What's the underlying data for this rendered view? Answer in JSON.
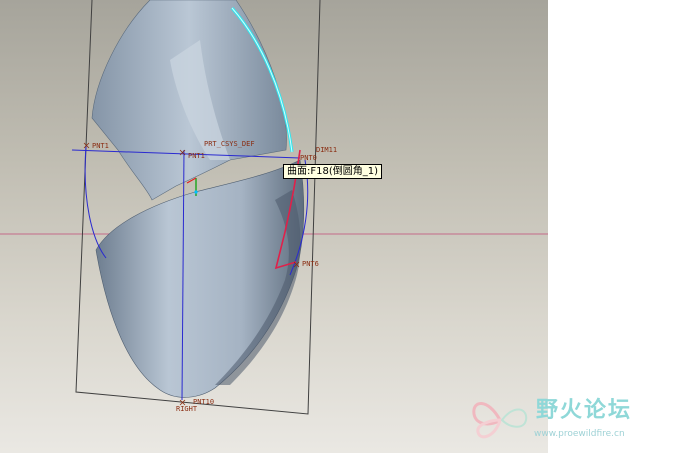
{
  "viewport": {
    "datum_labels": {
      "pnt1": "PNT1",
      "pnt_top": "PNT1",
      "pnt0": "PNT0",
      "pnt6": "PNT6",
      "pnt_bottom": "PNT10",
      "right": "RIGHT",
      "front_csys": "PRT_CSYS_DEF",
      "dim": "DIM11"
    }
  },
  "tooltip": {
    "text": "曲面:F18(倒圆角_1)"
  },
  "watermark": {
    "title": "野火论坛",
    "url": "www.proewildfire.cn"
  },
  "colors": {
    "surface": "#a9b6c6",
    "curve_blue": "#2a2ad0",
    "curve_red": "#e0204a",
    "highlight_cyan": "#2ee8f0",
    "datum_text": "#8a2d12"
  }
}
